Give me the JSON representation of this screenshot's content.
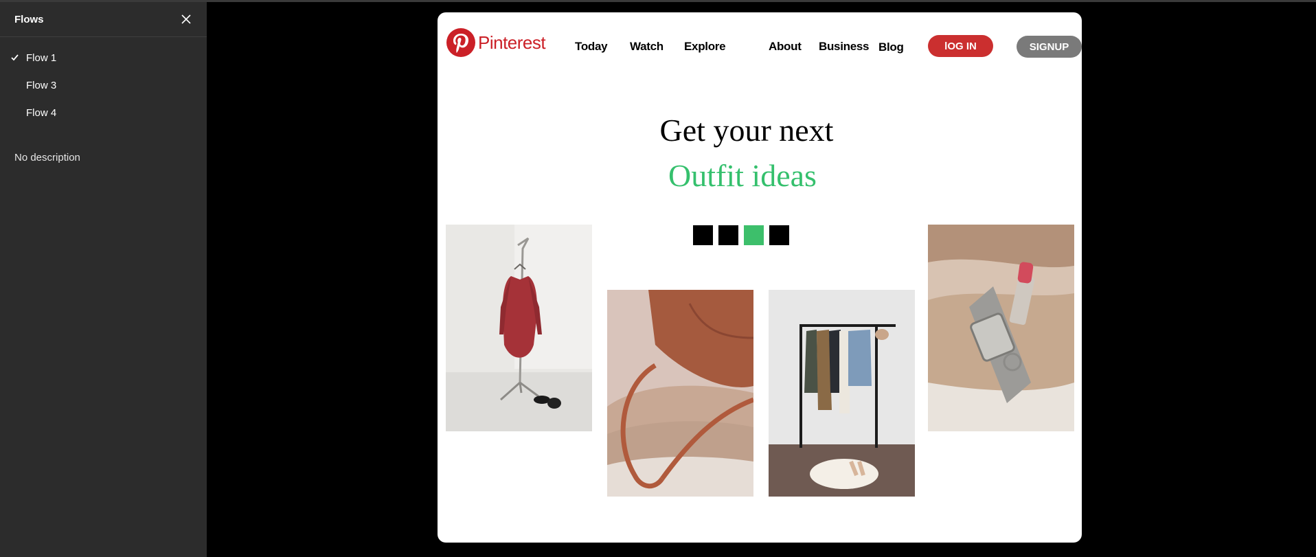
{
  "sidebar": {
    "title": "Flows",
    "flows": [
      {
        "label": "Flow 1",
        "selected": true
      },
      {
        "label": "Flow 3",
        "selected": false
      },
      {
        "label": "Flow 4",
        "selected": false
      }
    ],
    "description": "No description"
  },
  "site": {
    "logo_text": "Pinterest",
    "nav": [
      "Today",
      "Watch",
      "Explore",
      "About",
      "Business",
      "Blog"
    ],
    "login_label": "lOG IN",
    "signup_label": "SIGNUP",
    "headline": "Get your next",
    "subheadline": "Outfit ideas",
    "carousel": {
      "count": 4,
      "active_index": 2
    },
    "photos": [
      "red-dress-on-stand",
      "bag-on-folded-sweaters",
      "clothes-rack-with-rug",
      "watch-and-lipstick"
    ]
  },
  "colors": {
    "brand_red": "#cb2027",
    "login_red": "#cb2f2f",
    "signup_gray": "#7a7a7a",
    "accent_green": "#35c06d",
    "sidebar_bg": "#2c2c2c"
  }
}
